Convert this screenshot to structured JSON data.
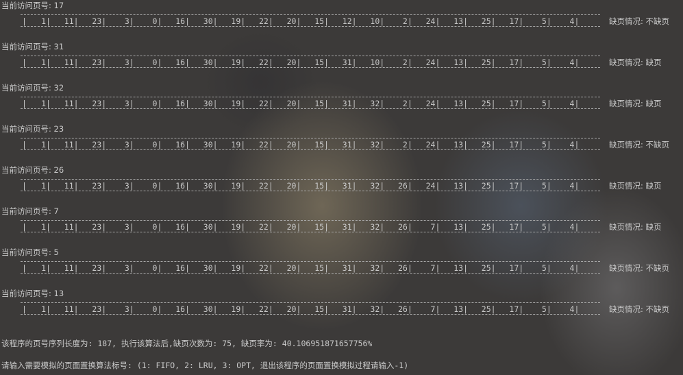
{
  "console": {
    "blocks": [
      {
        "label": "当前访问页号: 17",
        "frames": [
          "1",
          "11",
          "23",
          "3",
          "0",
          "16",
          "30",
          "19",
          "22",
          "20",
          "15",
          "12",
          "10",
          "2",
          "24",
          "13",
          "25",
          "17",
          "5",
          "4"
        ],
        "status": "缺页情况: 不缺页"
      },
      {
        "label": "当前访问页号: 31",
        "frames": [
          "1",
          "11",
          "23",
          "3",
          "0",
          "16",
          "30",
          "19",
          "22",
          "20",
          "15",
          "31",
          "10",
          "2",
          "24",
          "13",
          "25",
          "17",
          "5",
          "4"
        ],
        "status": "缺页情况: 缺页"
      },
      {
        "label": "当前访问页号: 32",
        "frames": [
          "1",
          "11",
          "23",
          "3",
          "0",
          "16",
          "30",
          "19",
          "22",
          "20",
          "15",
          "31",
          "32",
          "2",
          "24",
          "13",
          "25",
          "17",
          "5",
          "4"
        ],
        "status": "缺页情况: 缺页"
      },
      {
        "label": "当前访问页号: 23",
        "frames": [
          "1",
          "11",
          "23",
          "3",
          "0",
          "16",
          "30",
          "19",
          "22",
          "20",
          "15",
          "31",
          "32",
          "2",
          "24",
          "13",
          "25",
          "17",
          "5",
          "4"
        ],
        "status": "缺页情况: 不缺页"
      },
      {
        "label": "当前访问页号: 26",
        "frames": [
          "1",
          "11",
          "23",
          "3",
          "0",
          "16",
          "30",
          "19",
          "22",
          "20",
          "15",
          "31",
          "32",
          "26",
          "24",
          "13",
          "25",
          "17",
          "5",
          "4"
        ],
        "status": "缺页情况: 缺页"
      },
      {
        "label": "当前访问页号: 7",
        "frames": [
          "1",
          "11",
          "23",
          "3",
          "0",
          "16",
          "30",
          "19",
          "22",
          "20",
          "15",
          "31",
          "32",
          "26",
          "7",
          "13",
          "25",
          "17",
          "5",
          "4"
        ],
        "status": "缺页情况: 缺页"
      },
      {
        "label": "当前访问页号: 5",
        "frames": [
          "1",
          "11",
          "23",
          "3",
          "0",
          "16",
          "30",
          "19",
          "22",
          "20",
          "15",
          "31",
          "32",
          "26",
          "7",
          "13",
          "25",
          "17",
          "5",
          "4"
        ],
        "status": "缺页情况: 不缺页"
      },
      {
        "label": "当前访问页号: 13",
        "frames": [
          "1",
          "11",
          "23",
          "3",
          "0",
          "16",
          "30",
          "19",
          "22",
          "20",
          "15",
          "31",
          "32",
          "26",
          "7",
          "13",
          "25",
          "17",
          "5",
          "4"
        ],
        "status": "缺页情况: 不缺页"
      }
    ],
    "summary": "该程序的页号序列长度为: 187, 执行该算法后,缺页次数为: 75, 缺页率为: 40.106951871657756%",
    "prompt": "请输入需要模拟的页面置换算法标号: (1: FIFO, 2: LRU, 3: OPT, 退出该程序的页面置换模拟过程请输入-1)"
  }
}
